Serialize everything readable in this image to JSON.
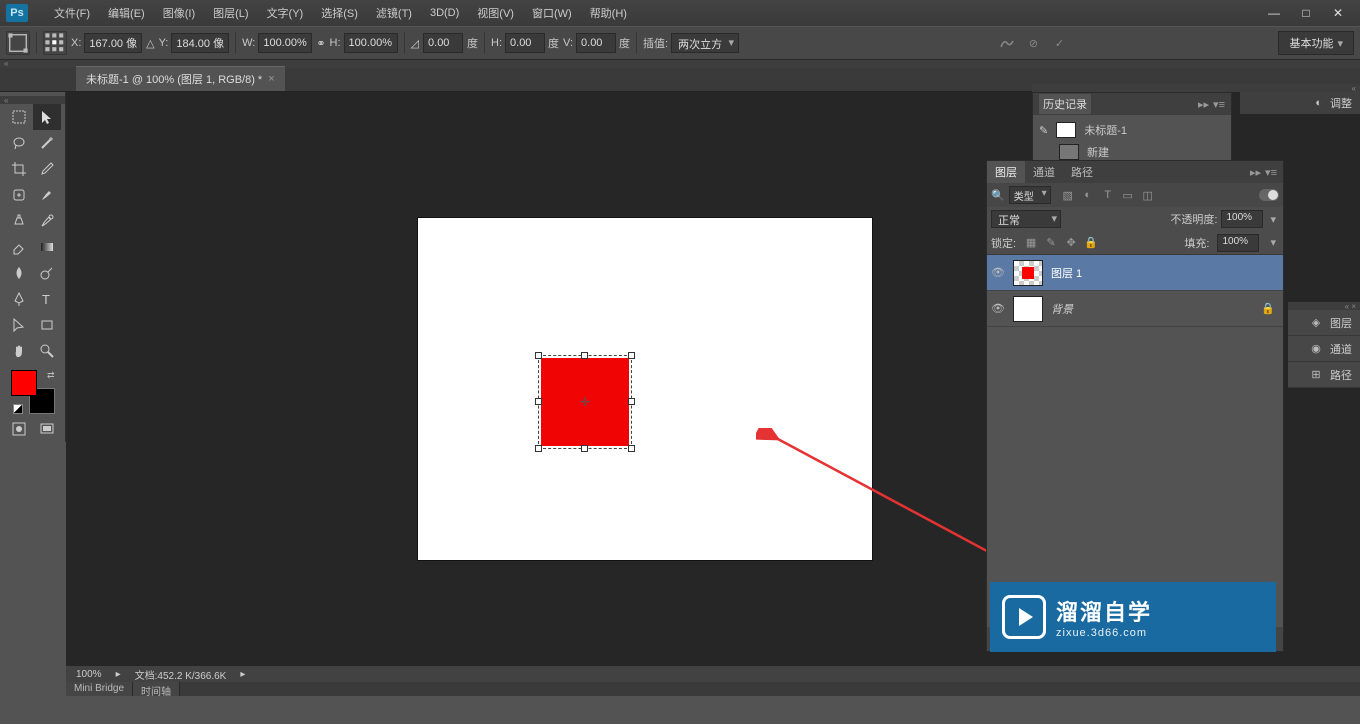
{
  "window": {
    "minimize": "—",
    "maximize": "□",
    "close": "✕"
  },
  "menubar": [
    "文件(F)",
    "编辑(E)",
    "图像(I)",
    "图层(L)",
    "文字(Y)",
    "选择(S)",
    "滤镜(T)",
    "3D(D)",
    "视图(V)",
    "窗口(W)",
    "帮助(H)"
  ],
  "optionbar": {
    "x_label": "X:",
    "x_val": "167.00 像",
    "y_label": "Y:",
    "y_val": "184.00 像",
    "w_label": "W:",
    "w_val": "100.00%",
    "h_label": "H:",
    "h_val": "100.00%",
    "angle_label": "",
    "angle_val": "0.00",
    "angle_unit": "度",
    "hskew_label": "H:",
    "hskew_val": "0.00",
    "hskew_unit": "度",
    "vskew_label": "V:",
    "vskew_val": "0.00",
    "vskew_unit": "度",
    "interp_label": "插值:",
    "interp_val": "两次立方",
    "workspace": "基本功能"
  },
  "doc_tab": {
    "title": "未标题-1 @ 100% (图层 1, RGB/8) *"
  },
  "colors": {
    "fg": "#ff0000",
    "bg": "#000000"
  },
  "history_panel": {
    "title": "历史记录",
    "items": [
      {
        "label": "未标题-1",
        "kind": "doc"
      },
      {
        "label": "新建",
        "kind": "step"
      }
    ]
  },
  "adjust_panel": {
    "title": "调整"
  },
  "layers_panel": {
    "tabs": [
      "图层",
      "通道",
      "路径"
    ],
    "filter_label": "类型",
    "blend_mode": "正常",
    "opacity_label": "不透明度:",
    "opacity_val": "100%",
    "lock_label": "锁定:",
    "fill_label": "填充:",
    "fill_val": "100%",
    "layers": [
      {
        "name": "图层 1",
        "selected": true,
        "checker": true,
        "red": true,
        "locked": false
      },
      {
        "name": "背景",
        "selected": false,
        "checker": false,
        "red": false,
        "locked": true,
        "italic": true
      }
    ]
  },
  "side_tabs": [
    {
      "icon": "◈",
      "label": "图层"
    },
    {
      "icon": "◉",
      "label": "通道"
    },
    {
      "icon": "⊞",
      "label": "路径"
    }
  ],
  "statusbar": {
    "zoom": "100%",
    "docinfo": "文档:452.2 K/366.6K"
  },
  "bottom_tabs": [
    "Mini Bridge",
    "时间轴"
  ],
  "watermark": {
    "main": "溜溜自学",
    "sub": "zixue.3d66.com"
  }
}
